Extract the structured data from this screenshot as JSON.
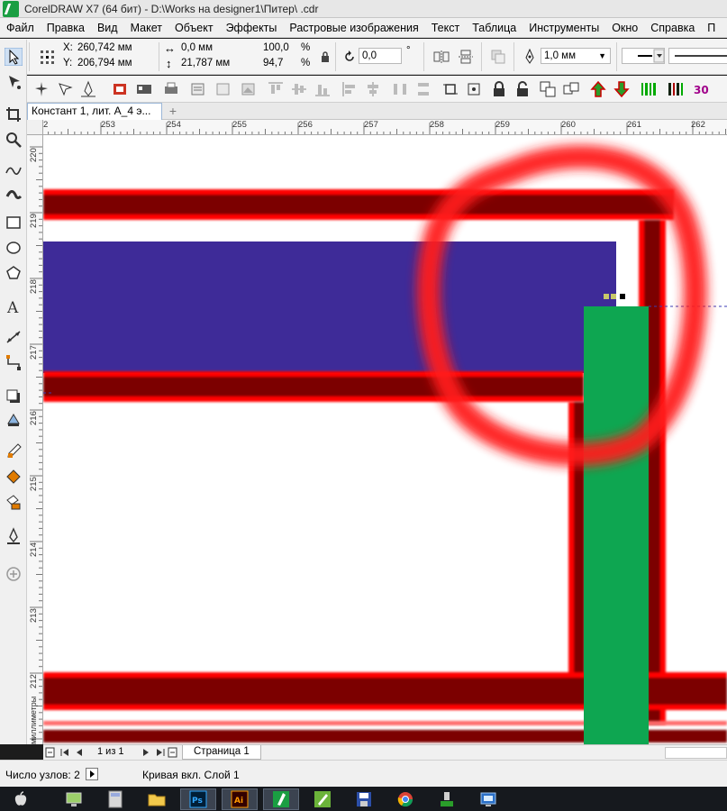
{
  "window": {
    "title": "CorelDRAW X7 (64 бит) - D:\\Works на designer1\\Питер\\                        .cdr"
  },
  "menu": {
    "items": [
      "Файл",
      "Правка",
      "Вид",
      "Макет",
      "Объект",
      "Эффекты",
      "Растровые изображения",
      "Текст",
      "Таблица",
      "Инструменты",
      "Окно",
      "Справка",
      "П"
    ]
  },
  "property_bar": {
    "x_label": "X:",
    "x_value": "260,742 мм",
    "y_label": "Y:",
    "y_value": "206,794 мм",
    "width_value": "0,0 мм",
    "height_value": "21,787 мм",
    "scale_x": "100,0",
    "scale_y": "94,7",
    "percent_1": "%",
    "percent_2": "%",
    "rotation": "0,0",
    "degree": "°",
    "outline_width": "1,0 мм"
  },
  "document": {
    "tab_label": "Констант 1, лит. А_4 э...",
    "add_tab": "+"
  },
  "rulers": {
    "top_ticks": [
      "2",
      "253",
      "254",
      "255",
      "256",
      "257",
      "258",
      "259",
      "260",
      "261",
      "262"
    ],
    "left_ticks": [
      "220",
      "219",
      "218",
      "217",
      "216",
      "215",
      "214",
      "213",
      "212"
    ],
    "units": "миллиметры"
  },
  "page_nav": {
    "counter": "1 из 1",
    "page_tab": "Страница 1"
  },
  "status": {
    "nodes": "Число узлов: 2",
    "object_info": "Кривая вкл. Слой 1"
  },
  "colors": {
    "blue_fill": "#3e2b98",
    "green_fill": "#0ea651",
    "dark_red": "#7b0000",
    "bright_red": "#ff0000",
    "annotation_red": "#ff1a1a"
  },
  "icons": {
    "taskbar": [
      "apple-icon",
      "monitor-icon",
      "calculator-icon",
      "folder-icon",
      "photoshop-icon",
      "illustrator-icon",
      "coreldraw-icon",
      "corel-capture-icon",
      "floppy-icon",
      "chrome-icon",
      "network-icon",
      "remote-icon"
    ]
  }
}
